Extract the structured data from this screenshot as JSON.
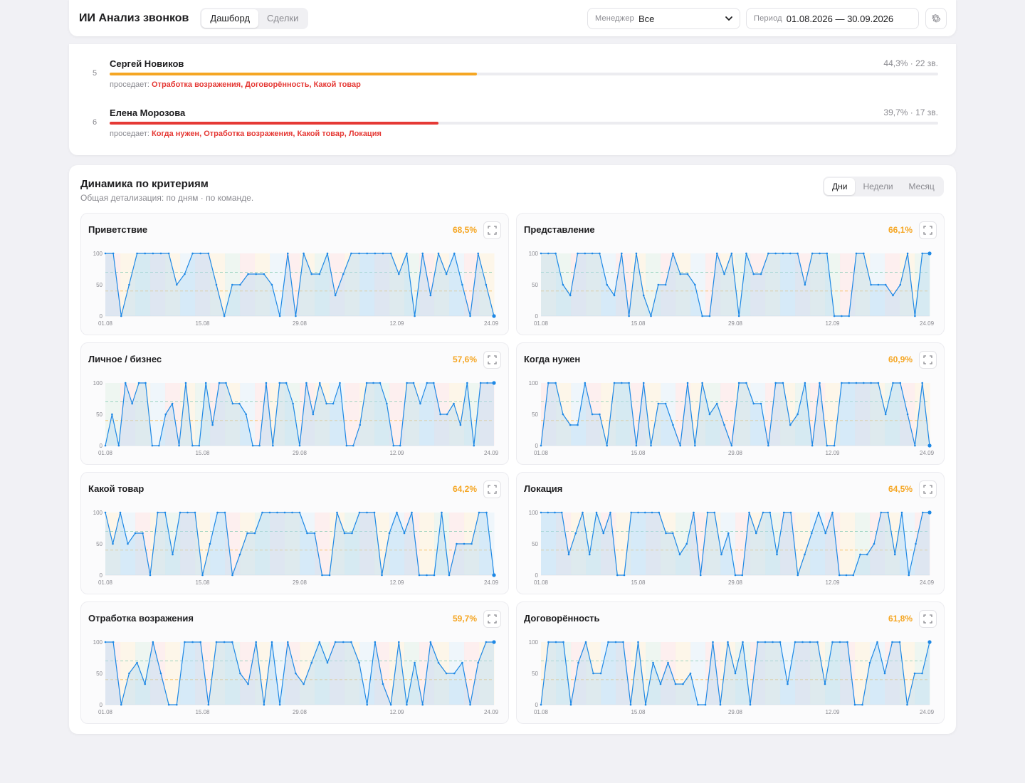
{
  "header": {
    "title": "ИИ Анализ звонков",
    "tabs": [
      {
        "label": "Дашборд",
        "active": true
      },
      {
        "label": "Сделки",
        "active": false
      }
    ],
    "manager_label": "Менеджер",
    "manager_value": "Все",
    "period_label": "Период",
    "period_value": "01.08.2026 — 30.09.2026"
  },
  "managers": [
    {
      "rank": "5",
      "name": "Сергей Новиков",
      "stat": "44,3% · 22 зв.",
      "progress": 0.443,
      "color": "#f5a623",
      "weak_label": "проседает:",
      "weak": "Отработка возражения, Договорённость, Какой товар"
    },
    {
      "rank": "6",
      "name": "Елена Морозова",
      "stat": "39,7% · 17 зв.",
      "progress": 0.397,
      "color": "#e53935",
      "weak_label": "проседает:",
      "weak": "Когда нужен, Отработка возражения, Какой товар, Локация"
    }
  ],
  "dynamics": {
    "title": "Динамика по критериям",
    "subtitle": "Общая детализация: по дням · по команде.",
    "granularity": [
      {
        "label": "Дни",
        "active": true
      },
      {
        "label": "Недели",
        "active": false
      },
      {
        "label": "Месяц",
        "active": false
      }
    ]
  },
  "colors": {
    "line": "#1e88e5",
    "pct": "#f5a623",
    "bad": "#e53935",
    "warn": "#f5a623"
  },
  "chart_data": [
    {
      "type": "line",
      "title": "Приветствие",
      "pct": "68,5%",
      "yticks": [
        "100",
        "50",
        "0"
      ],
      "xticks": [
        "01.08",
        "15.08",
        "29.08",
        "12.09",
        "24.09"
      ],
      "ylim": [
        0,
        100
      ],
      "values": [
        100,
        100,
        0,
        50,
        100,
        100,
        100,
        100,
        100,
        50,
        67,
        100,
        100,
        100,
        50,
        0,
        50,
        50,
        67,
        67,
        67,
        50,
        0,
        100,
        0,
        100,
        67,
        67,
        100,
        33,
        67,
        100,
        100,
        100,
        100,
        100,
        100,
        67,
        100,
        0,
        100,
        33,
        100,
        67,
        100,
        50,
        0,
        100,
        50,
        0
      ]
    },
    {
      "type": "line",
      "title": "Представление",
      "pct": "66,1%",
      "yticks": [
        "100",
        "50",
        "0"
      ],
      "xticks": [
        "01.08",
        "15.08",
        "29.08",
        "12.09",
        "24.09"
      ],
      "ylim": [
        0,
        100
      ],
      "values": [
        100,
        100,
        100,
        50,
        33,
        100,
        100,
        100,
        100,
        50,
        33,
        100,
        0,
        100,
        33,
        0,
        50,
        50,
        100,
        67,
        67,
        50,
        0,
        0,
        100,
        67,
        100,
        0,
        100,
        67,
        67,
        100,
        100,
        100,
        100,
        100,
        50,
        100,
        100,
        100,
        0,
        0,
        0,
        100,
        100,
        50,
        50,
        50,
        33,
        50,
        100,
        0,
        100,
        100
      ]
    },
    {
      "type": "line",
      "title": "Личное / бизнес",
      "pct": "57,6%",
      "yticks": [
        "100",
        "50",
        "0"
      ],
      "xticks": [
        "01.08",
        "15.08",
        "29.08",
        "12.09",
        "24.09"
      ],
      "ylim": [
        0,
        100
      ],
      "values": [
        0,
        50,
        0,
        100,
        67,
        100,
        100,
        0,
        0,
        50,
        67,
        0,
        100,
        0,
        0,
        100,
        33,
        100,
        100,
        67,
        67,
        50,
        0,
        0,
        100,
        0,
        100,
        100,
        67,
        0,
        100,
        50,
        100,
        67,
        67,
        100,
        0,
        0,
        33,
        100,
        100,
        100,
        67,
        0,
        0,
        100,
        100,
        67,
        100,
        100,
        50,
        50,
        67,
        33,
        100,
        0,
        100,
        100,
        100
      ]
    },
    {
      "type": "line",
      "title": "Когда нужен",
      "pct": "60,9%",
      "yticks": [
        "100",
        "50",
        "0"
      ],
      "xticks": [
        "01.08",
        "15.08",
        "29.08",
        "12.09",
        "24.09"
      ],
      "ylim": [
        0,
        100
      ],
      "values": [
        0,
        100,
        100,
        50,
        33,
        33,
        100,
        50,
        50,
        0,
        100,
        100,
        100,
        0,
        100,
        0,
        67,
        67,
        33,
        0,
        100,
        0,
        100,
        50,
        67,
        33,
        0,
        100,
        100,
        67,
        67,
        0,
        100,
        100,
        33,
        50,
        100,
        0,
        100,
        0,
        0,
        100,
        100,
        100,
        100,
        100,
        100,
        50,
        100,
        100,
        50,
        0,
        100,
        0
      ]
    },
    {
      "type": "line",
      "title": "Какой товар",
      "pct": "64,2%",
      "yticks": [
        "100",
        "50",
        "0"
      ],
      "xticks": [
        "01.08",
        "15.08",
        "29.08",
        "12.09",
        "24.09"
      ],
      "ylim": [
        0,
        100
      ],
      "values": [
        100,
        50,
        100,
        50,
        67,
        67,
        0,
        100,
        100,
        33,
        100,
        100,
        100,
        0,
        50,
        100,
        100,
        0,
        33,
        67,
        67,
        100,
        100,
        100,
        100,
        100,
        100,
        67,
        67,
        0,
        0,
        100,
        67,
        67,
        100,
        100,
        100,
        0,
        67,
        100,
        67,
        100,
        0,
        0,
        0,
        100,
        0,
        50,
        50,
        50,
        100,
        100,
        0
      ]
    },
    {
      "type": "line",
      "title": "Локация",
      "pct": "64,5%",
      "yticks": [
        "100",
        "50",
        "0"
      ],
      "xticks": [
        "01.08",
        "15.08",
        "29.08",
        "12.09",
        "24.09"
      ],
      "ylim": [
        0,
        100
      ],
      "values": [
        100,
        100,
        100,
        100,
        33,
        67,
        100,
        33,
        100,
        67,
        100,
        0,
        0,
        100,
        100,
        100,
        100,
        100,
        67,
        67,
        33,
        50,
        100,
        0,
        100,
        100,
        33,
        67,
        0,
        0,
        100,
        67,
        100,
        100,
        33,
        100,
        100,
        0,
        33,
        67,
        100,
        67,
        100,
        0,
        0,
        0,
        33,
        33,
        50,
        100,
        100,
        33,
        100,
        0,
        50,
        100,
        100
      ]
    },
    {
      "type": "line",
      "title": "Отработка возражения",
      "pct": "59,7%",
      "yticks": [
        "100",
        "50",
        "0"
      ],
      "xticks": [
        "01.08",
        "15.08",
        "29.08",
        "12.09",
        "24.09"
      ],
      "ylim": [
        0,
        100
      ],
      "values": [
        100,
        100,
        0,
        50,
        67,
        33,
        100,
        50,
        0,
        0,
        100,
        100,
        100,
        0,
        100,
        100,
        100,
        50,
        33,
        100,
        0,
        100,
        0,
        100,
        50,
        33,
        67,
        100,
        67,
        100,
        100,
        100,
        67,
        0,
        100,
        33,
        0,
        100,
        0,
        67,
        0,
        100,
        67,
        50,
        50,
        67,
        0,
        67,
        100,
        100
      ]
    },
    {
      "type": "line",
      "title": "Договорённость",
      "pct": "61,8%",
      "yticks": [
        "100",
        "50",
        "0"
      ],
      "xticks": [
        "01.08",
        "15.08",
        "29.08",
        "12.09",
        "24.09"
      ],
      "ylim": [
        0,
        100
      ],
      "values": [
        0,
        100,
        100,
        100,
        0,
        67,
        100,
        50,
        50,
        100,
        100,
        100,
        0,
        100,
        0,
        67,
        33,
        67,
        33,
        33,
        50,
        0,
        0,
        100,
        0,
        100,
        50,
        100,
        0,
        100,
        100,
        100,
        100,
        33,
        100,
        100,
        100,
        100,
        33,
        100,
        100,
        100,
        0,
        0,
        67,
        100,
        50,
        100,
        100,
        0,
        50,
        50,
        100
      ]
    }
  ]
}
